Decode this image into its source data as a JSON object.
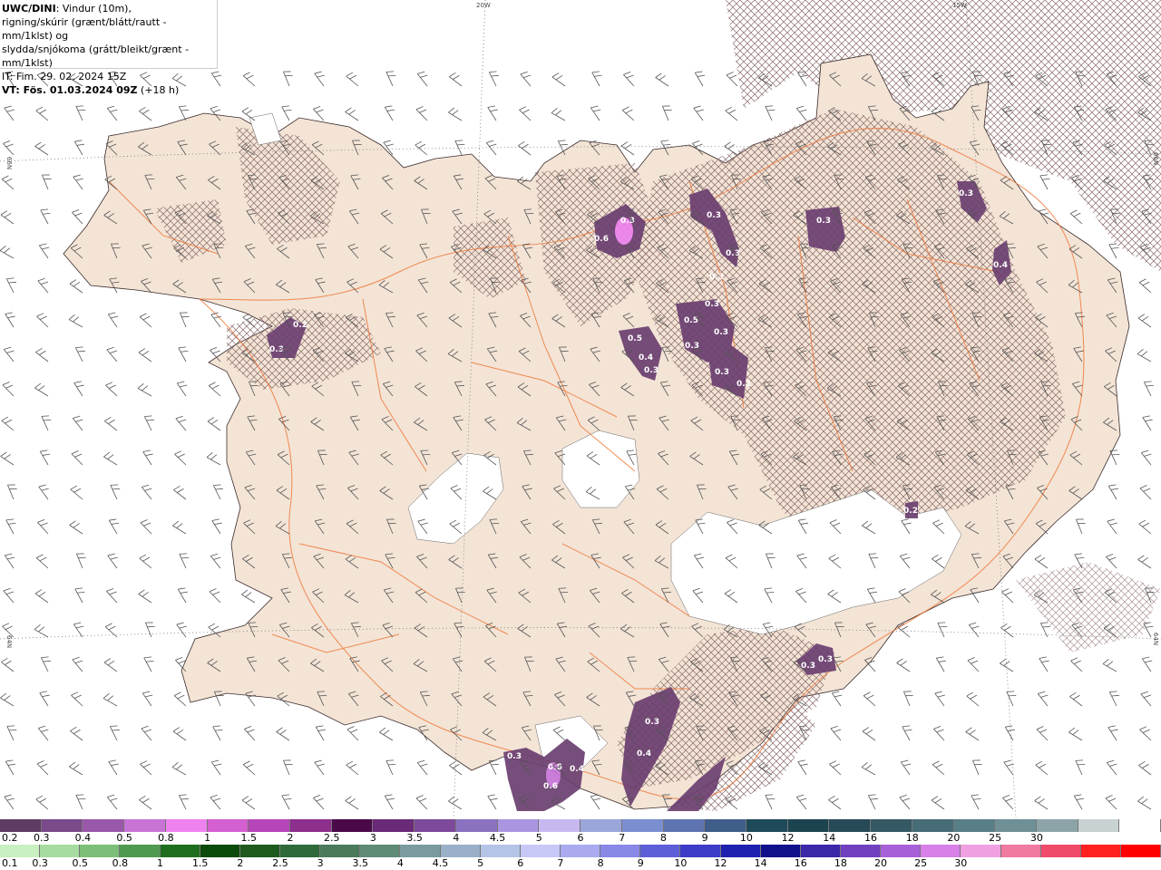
{
  "header": {
    "model": "UWC/DINI",
    "line1_rest": ": Vindur (10m),",
    "line2": "rigning/skúrir (grænt/blátt/rautt - mm/1klst) og",
    "line3": "slydda/snjókoma (grátt/bleikt/grænt - mm/1klst)",
    "it": "IT: Fim. 29. 02. 2024 15Z",
    "vt_bold": "VT: Fös. 01.03.2024 09Z",
    "vt_rest": " (+18 h)"
  },
  "graticule_labels": {
    "top_20w": "20W",
    "top_15w": "15W",
    "left_66n": "66N",
    "left_64n": "64N",
    "right_66n": "66N",
    "right_64n": "64N"
  },
  "precip_labels": [
    "0.3",
    "0.6",
    "0.3",
    "0.3",
    "0.3",
    "0.3",
    "0.3",
    "0.4",
    "0.2",
    "0.3",
    "0.5",
    "0.3",
    "0.3",
    "0.4",
    "0.5",
    "0.3",
    "0.3",
    "0.3",
    "0.2",
    "0.3",
    "0.3",
    "0.3",
    "0.4",
    "0.3",
    "0.8",
    "0.6",
    "0.4",
    "0.2"
  ],
  "legend_snow": {
    "colors": [
      "#5e3c64",
      "#7a4a8a",
      "#9a58aa",
      "#c774d6",
      "#ee82ee",
      "#d35fd0",
      "#b545b8",
      "#8e2f8e",
      "#4a0a4a",
      "#6a2a78",
      "#7d4a9a",
      "#8a72c0",
      "#aa96e0",
      "#c8b8f0",
      "#9aa6da",
      "#7a8ed0",
      "#5d74b0",
      "#3f5e8a",
      "#1e4a5a",
      "#1c4450",
      "#274a58",
      "#355a66",
      "#466c78",
      "#587e88",
      "#6e9096",
      "#8ca4a8",
      "#c8d2d2",
      "#ffffff"
    ],
    "labels": [
      "0.2",
      "0.3",
      "0.4",
      "0.5",
      "0.8",
      "1",
      "1.5",
      "2",
      "2.5",
      "3",
      "3.5",
      "4",
      "4.5",
      "5",
      "6",
      "7",
      "8",
      "9",
      "10",
      "12",
      "14",
      "16",
      "18",
      "20",
      "25",
      "30"
    ]
  },
  "legend_rain": {
    "colors": [
      "#c8f0c0",
      "#a6dca0",
      "#7cbf78",
      "#4f9a4e",
      "#1f6e20",
      "#0a4a0a",
      "#1e5a1e",
      "#2e6a3a",
      "#4a7a5a",
      "#5e8a76",
      "#7a9aa0",
      "#9ab0c8",
      "#b4c4e6",
      "#c8c8f8",
      "#aaaaf0",
      "#8888e6",
      "#5e5ed8",
      "#3c3cc8",
      "#2020b0",
      "#10108a",
      "#3a28a8",
      "#7040c0",
      "#a860d8",
      "#d880e8",
      "#f0a0e0",
      "#f07aa0",
      "#f04a6a",
      "#ff2020",
      "#ff0000"
    ],
    "labels": [
      "0.1",
      "0.3",
      "0.5",
      "0.8",
      "1",
      "1.5",
      "2",
      "2.5",
      "3",
      "3.5",
      "4",
      "4.5",
      "5",
      "6",
      "7",
      "8",
      "9",
      "10",
      "12",
      "14",
      "16",
      "18",
      "20",
      "25",
      "30"
    ]
  },
  "colors": {
    "land": "#f3e4d6",
    "ice": "#ffffff",
    "road": "#f07838",
    "snow_area": "#6b3f70",
    "hatch": "#8a6a6a",
    "wind": "#555555"
  }
}
